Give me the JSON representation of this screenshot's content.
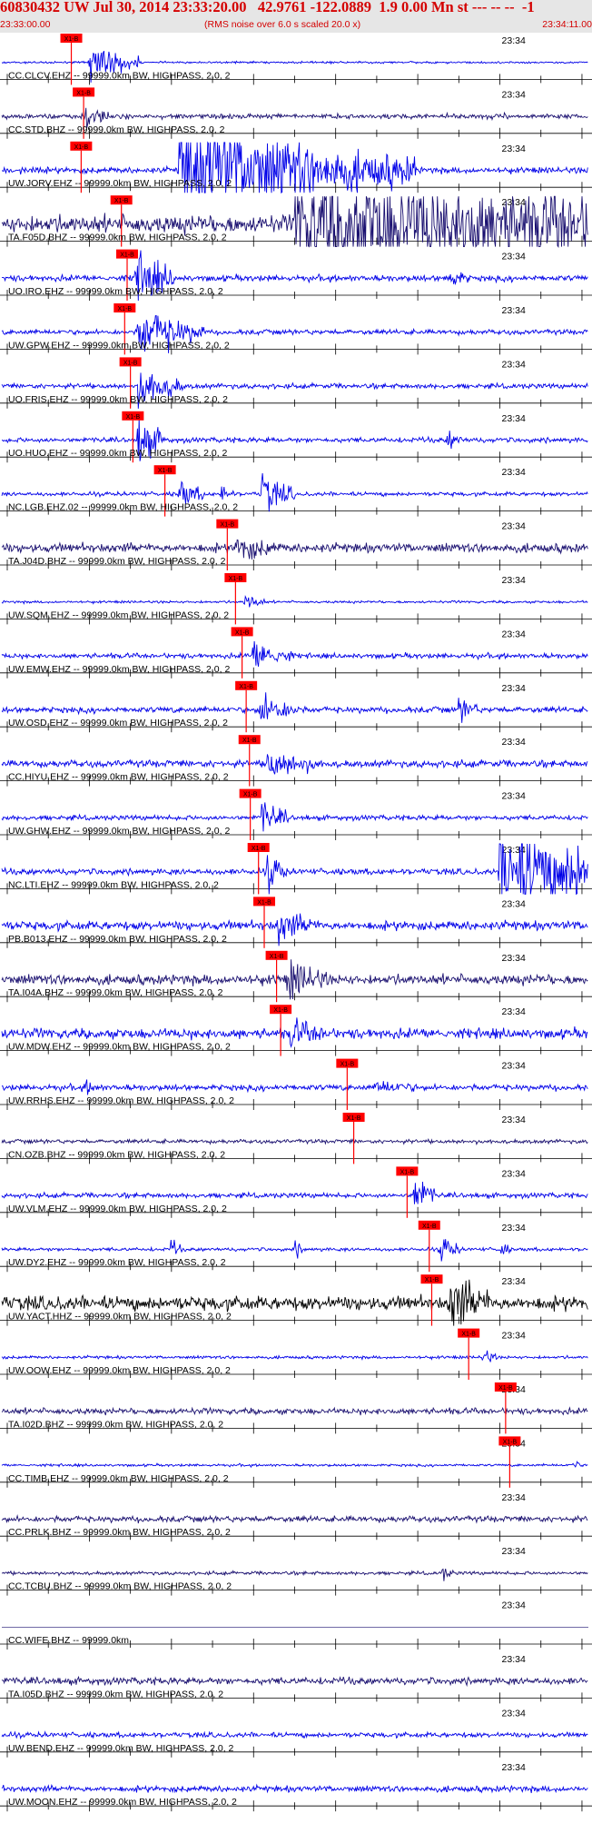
{
  "header": {
    "title": "60830432 UW Jul 30, 2014 23:33:20.00   42.9761 -122.0889  1.9 0.00 Mn st --- -- --  -1",
    "start_time": "23:33:00.00",
    "note": "(RMS noise over 6.0 s scaled 20.0 x)",
    "end_time": "23:34:11.00"
  },
  "colors": {
    "header_text": "#d40000",
    "header_bg": "#e6e6e6",
    "trace_blue": "#0000e8",
    "trace_navy": "#1a1070",
    "trace_black": "#000000",
    "pick_red": "#ff0000"
  },
  "chart_data": {
    "type": "line",
    "title": "",
    "x_axis": {
      "start": "23:33:00.00",
      "end": "23:34:11.00",
      "tick_label": "23:34",
      "tick_label_time": "23:34:00"
    },
    "pick_label": "X1-B",
    "channels": [
      {
        "label": "CC.CLCV.EHZ -- 99999.0km BW, HIGHPASS, 2.0, 2",
        "color": "#0000e8",
        "pick_time": "23:33:07.8",
        "noise": 0.04,
        "events": [
          {
            "t": "23:33:10.0",
            "amp": 0.9,
            "dur": 4
          }
        ]
      },
      {
        "label": "CC.STD.BHZ -- 99999.0km BW, HIGHPASS, 2.0, 2",
        "color": "#1a1070",
        "pick_time": "23:33:09.3",
        "noise": 0.1,
        "events": [
          {
            "t": "23:33:09.5",
            "amp": 0.5,
            "dur": 2
          }
        ]
      },
      {
        "label": "UW.JORV.EHZ -- 99999.0km BW, HIGHPASS, 2.0, 2",
        "color": "#0000e8",
        "pick_time": "23:33:09.0",
        "noise": 0.12,
        "events": [
          {
            "t": "23:33:21.0",
            "amp": 2.4,
            "dur": 18
          }
        ]
      },
      {
        "label": "TA.F05D.BHZ -- 99999.0km BW, HIGHPASS, 2.0, 2",
        "color": "#1a1070",
        "pick_time": "23:33:13.9",
        "noise": 0.35,
        "events": [
          {
            "t": "23:33:35.0",
            "amp": 1.9,
            "dur": 55
          }
        ]
      },
      {
        "label": "UO.IRO.EHZ -- 99999.0km BW, HIGHPASS, 2.0, 2",
        "color": "#0000e8",
        "pick_time": "23:33:14.6",
        "noise": 0.12,
        "events": [
          {
            "t": "23:33:15.6",
            "amp": 1.3,
            "dur": 3
          },
          {
            "t": "23:33:53.8",
            "amp": 0.4,
            "dur": 1.5
          }
        ]
      },
      {
        "label": "UW.GPW.EHZ -- 99999.0km BW, HIGHPASS, 2.0, 2",
        "color": "#0000e8",
        "pick_time": "23:33:14.3",
        "noise": 0.1,
        "events": [
          {
            "t": "23:33:16.0",
            "amp": 1.1,
            "dur": 5
          }
        ]
      },
      {
        "label": "UO.FRIS.EHZ -- 99999.0km BW, HIGHPASS, 2.0, 2",
        "color": "#0000e8",
        "pick_time": "23:33:15.0",
        "noise": 0.1,
        "events": [
          {
            "t": "23:33:16.0",
            "amp": 1.1,
            "dur": 2.5
          },
          {
            "t": "23:33:20.0",
            "amp": 0.5,
            "dur": 1
          }
        ]
      },
      {
        "label": "UO.HUO.EHZ -- 99999.0km BW, HIGHPASS, 2.0, 2",
        "color": "#0000e8",
        "pick_time": "23:33:15.3",
        "noise": 0.1,
        "events": [
          {
            "t": "23:33:16.0",
            "amp": 1.2,
            "dur": 2
          },
          {
            "t": "23:33:53.7",
            "amp": 0.4,
            "dur": 1
          }
        ]
      },
      {
        "label": "NC.LGB.EHZ.02 -- 99999.0km BW, HIGHPASS, 2.0, 2",
        "color": "#0000e8",
        "pick_time": "23:33:19.2",
        "noise": 0.08,
        "events": [
          {
            "t": "23:33:21.0",
            "amp": 0.6,
            "dur": 2
          },
          {
            "t": "23:33:26.0",
            "amp": 0.4,
            "dur": 1
          },
          {
            "t": "23:33:31.0",
            "amp": 0.9,
            "dur": 2.5
          }
        ]
      },
      {
        "label": "TA.J04D.BHZ -- 99999.0km BW, HIGHPASS, 2.0, 2",
        "color": "#1a1070",
        "pick_time": "23:33:26.8",
        "noise": 0.18,
        "events": [
          {
            "t": "23:33:28.0",
            "amp": 0.5,
            "dur": 3
          }
        ]
      },
      {
        "label": "UW.SQM.EHZ -- 99999.0km BW, HIGHPASS, 2.0, 2",
        "color": "#0000e8",
        "pick_time": "23:33:27.8",
        "noise": 0.05,
        "events": [
          {
            "t": "23:33:29.0",
            "amp": 0.4,
            "dur": 1.5
          }
        ]
      },
      {
        "label": "UW.EMW.EHZ -- 99999.0km BW, HIGHPASS, 2.0, 2",
        "color": "#0000e8",
        "pick_time": "23:33:28.6",
        "noise": 0.1,
        "events": [
          {
            "t": "23:33:30.0",
            "amp": 0.7,
            "dur": 3
          }
        ]
      },
      {
        "label": "UW.OSD.EHZ -- 99999.0km BW, HIGHPASS, 2.0, 2",
        "color": "#0000e8",
        "pick_time": "23:33:29.1",
        "noise": 0.12,
        "events": [
          {
            "t": "23:33:30.8",
            "amp": 0.7,
            "dur": 3
          },
          {
            "t": "23:33:55.0",
            "amp": 0.5,
            "dur": 1.5
          }
        ]
      },
      {
        "label": "CC.HIYU.EHZ -- 99999.0km BW, HIGHPASS, 2.0, 2",
        "color": "#0000e8",
        "pick_time": "23:33:29.5",
        "noise": 0.14,
        "events": [
          {
            "t": "23:33:31.5",
            "amp": 0.6,
            "dur": 4
          }
        ]
      },
      {
        "label": "UW.GHW.EHZ -- 99999.0km BW, HIGHPASS, 2.0, 2",
        "color": "#0000e8",
        "pick_time": "23:33:29.6",
        "noise": 0.1,
        "events": [
          {
            "t": "23:33:31.0",
            "amp": 0.7,
            "dur": 2
          }
        ]
      },
      {
        "label": "NC.LTI.EHZ -- 99999.0km BW, HIGHPASS, 2.0, 2",
        "color": "#0000e8",
        "pick_time": "23:33:30.6",
        "noise": 0.12,
        "events": [
          {
            "t": "23:33:31.6",
            "amp": 0.9,
            "dur": 1.5
          },
          {
            "t": "23:34:00.0",
            "amp": 1.9,
            "dur": 16
          }
        ]
      },
      {
        "label": "PB.B013.EHZ -- 99999.0km BW, HIGHPASS, 2.0, 2",
        "color": "#0000e8",
        "pick_time": "23:33:31.3",
        "noise": 0.18,
        "events": [
          {
            "t": "23:33:33.0",
            "amp": 0.6,
            "dur": 3
          }
        ]
      },
      {
        "label": "TA.I04A.BHZ -- 99999.0km BW, HIGHPASS, 2.0, 2",
        "color": "#1a1070",
        "pick_time": "23:33:32.8",
        "noise": 0.2,
        "events": [
          {
            "t": "23:33:34.2",
            "amp": 0.8,
            "dur": 3
          }
        ]
      },
      {
        "label": "UW.MDW.EHZ -- 99999.0km BW, HIGHPASS, 2.0, 2",
        "color": "#0000e8",
        "pick_time": "23:33:33.3",
        "noise": 0.2,
        "events": [
          {
            "t": "23:33:34.5",
            "amp": 0.5,
            "dur": 3
          }
        ]
      },
      {
        "label": "UW.RRHS.EHZ -- 99999.0km BW, HIGHPASS, 2.0, 2",
        "color": "#0000e8",
        "pick_time": "23:33:41.4",
        "noise": 0.12,
        "events": [
          {
            "t": "23:33:09.5",
            "amp": 0.3,
            "dur": 1
          },
          {
            "t": "23:33:45.0",
            "amp": 0.25,
            "dur": 3
          }
        ]
      },
      {
        "label": "CN.OZB.BHZ -- 99999.0km BW, HIGHPASS, 2.0, 2",
        "color": "#1a1070",
        "pick_time": "23:33:42.2",
        "noise": 0.08,
        "events": []
      },
      {
        "label": "UW.VLM.EHZ -- 99999.0km BW, HIGHPASS, 2.0, 2",
        "color": "#0000e8",
        "pick_time": "23:33:48.7",
        "noise": 0.1,
        "events": [
          {
            "t": "23:33:49.6",
            "amp": 1.0,
            "dur": 1.5
          }
        ]
      },
      {
        "label": "UW.DY2.EHZ -- 99999.0km BW, HIGHPASS, 2.0, 2",
        "color": "#0000e8",
        "pick_time": "23:33:51.4",
        "noise": 0.07,
        "events": [
          {
            "t": "23:33:52.8",
            "amp": 0.6,
            "dur": 1.5
          },
          {
            "t": "23:33:20.0",
            "amp": 0.4,
            "dur": 0.8
          },
          {
            "t": "23:33:35.0",
            "amp": 0.35,
            "dur": 0.8
          },
          {
            "t": "23:34:00.0",
            "amp": 0.4,
            "dur": 0.8
          }
        ]
      },
      {
        "label": "UW.YACT.HHZ -- 99999.0km BW, HIGHPASS, 2.0, 2",
        "color": "#000000",
        "pick_time": "23:33:51.7",
        "noise": 0.28,
        "events": [
          {
            "t": "23:33:54.0",
            "amp": 1.2,
            "dur": 3
          }
        ]
      },
      {
        "label": "UW.OOW.EHZ -- 99999.0km BW, HIGHPASS, 2.0, 2",
        "color": "#0000e8",
        "pick_time": "23:33:56.2",
        "noise": 0.06,
        "events": [
          {
            "t": "23:33:58.0",
            "amp": 0.4,
            "dur": 1
          }
        ]
      },
      {
        "label": "TA.I02D.BHZ -- 99999.0km BW, HIGHPASS, 2.0, 2",
        "color": "#1a1070",
        "pick_time": "23:34:00.7",
        "noise": 0.12,
        "events": []
      },
      {
        "label": "CC.TIMB.EHZ -- 99999.0km BW, HIGHPASS, 2.0, 2",
        "color": "#0000e8",
        "pick_time": "23:34:01.2",
        "noise": 0.05,
        "events": [
          {
            "t": "23:34:09.0",
            "amp": 0.3,
            "dur": 0.5
          }
        ]
      },
      {
        "label": "CC.PRLK.BHZ -- 99999.0km BW, HIGHPASS, 2.0, 2",
        "color": "#1a1070",
        "pick_time": "",
        "noise": 0.12,
        "events": []
      },
      {
        "label": "CC.TCBU.BHZ -- 99999.0km BW, HIGHPASS, 2.0, 2",
        "color": "#1a1070",
        "pick_time": "",
        "noise": 0.07,
        "events": [
          {
            "t": "23:33:53.0",
            "amp": 0.3,
            "dur": 0.8
          }
        ]
      },
      {
        "label": "CC.WIFE.BHZ -- 99999.0km",
        "color": "#1a1070",
        "pick_time": "",
        "noise": 0,
        "events": []
      },
      {
        "label": "TA.I05D.BHZ -- 99999.0km BW, HIGHPASS, 2.0, 2",
        "color": "#1a1070",
        "pick_time": "",
        "noise": 0.14,
        "events": []
      },
      {
        "label": "UW.BEND.EHZ -- 99999.0km BW, HIGHPASS, 2.0, 2",
        "color": "#0000e8",
        "pick_time": "",
        "noise": 0.1,
        "events": []
      },
      {
        "label": "UW.MOON.EHZ -- 99999.0km BW, HIGHPASS, 2.0, 2",
        "color": "#0000e8",
        "pick_time": "",
        "noise": 0.12,
        "events": []
      }
    ]
  }
}
